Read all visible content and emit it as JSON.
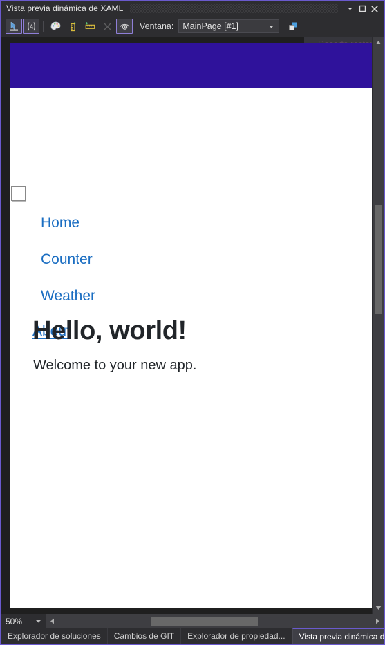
{
  "window": {
    "title": "Vista previa dinámica de XAML",
    "buttons": {
      "dropdown": "▾",
      "maximize": "▢",
      "close": "✕"
    }
  },
  "toolbar": {
    "tools": [
      {
        "name": "select-element-tool",
        "title": "Seleccionar elemento"
      },
      {
        "name": "display-text-tool",
        "title": "Mostrar texto"
      },
      {
        "name": "color-palette-tool",
        "title": "Paleta de colores"
      },
      {
        "name": "vertical-ruler-tool",
        "title": "Regla vertical"
      },
      {
        "name": "horizontal-ruler-tool",
        "title": "Regla horizontal"
      },
      {
        "name": "clear-tool",
        "title": "Borrar"
      },
      {
        "name": "preview-eye-tool",
        "title": "Vista previa"
      }
    ],
    "window_label": "Ventana:",
    "window_value": "MainPage [#1]",
    "popout_title": "Desacoplar ventana"
  },
  "ghost_tooltip": "Recorte rectangular",
  "preview": {
    "header_color": "#2f129b",
    "background_color": "#ffffff",
    "nav_toggle_label": "",
    "links": [
      {
        "label": "Home",
        "underlined": false
      },
      {
        "label": "Counter",
        "underlined": false
      },
      {
        "label": "Weather",
        "underlined": false
      },
      {
        "label": "About",
        "underlined": true
      }
    ],
    "link_color": "#1b6ec2",
    "hero_title": "Hello, world!",
    "hero_subtitle": "Welcome to your new app.",
    "text_color": "#212529"
  },
  "zoom": {
    "value": "50%",
    "arrow": "▾"
  },
  "scroll": {
    "v_up": "▲",
    "v_down": "▼",
    "h_left": "◀",
    "h_right": "▶"
  },
  "tabs": [
    {
      "label": "Explorador de soluciones",
      "active": false
    },
    {
      "label": "Cambios de GIT",
      "active": false
    },
    {
      "label": "Explorador de propiedad...",
      "active": false
    },
    {
      "label": "Vista previa dinámica de...",
      "active": true
    }
  ]
}
